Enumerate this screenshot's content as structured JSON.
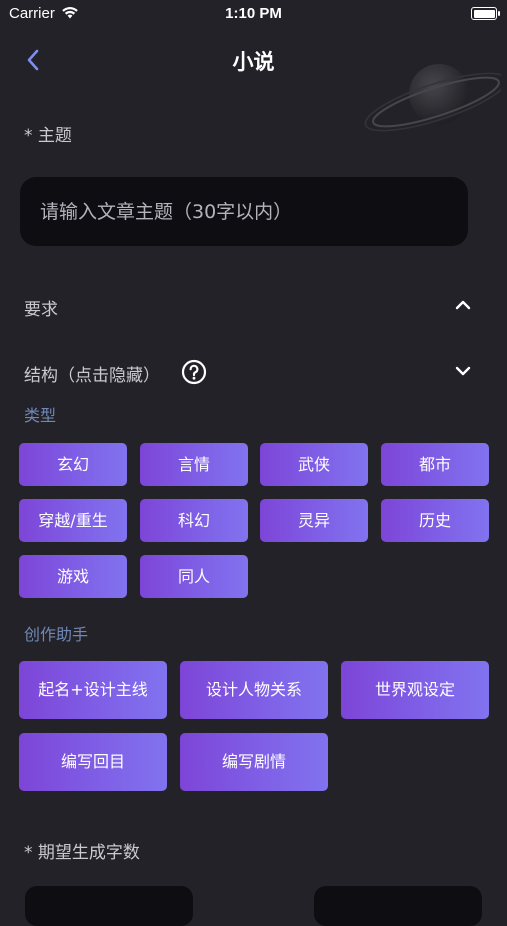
{
  "status_bar": {
    "carrier": "Carrier",
    "time": "1:10 PM"
  },
  "nav": {
    "title": "小说"
  },
  "topic": {
    "label": "* 主题",
    "placeholder": "请输入文章主题（30字以内）"
  },
  "requirements": {
    "label": "要求"
  },
  "structure": {
    "label": "结构（点击隐藏）"
  },
  "genre": {
    "heading": "类型",
    "items": [
      "玄幻",
      "言情",
      "武侠",
      "都市",
      "穿越/重生",
      "科幻",
      "灵异",
      "历史",
      "游戏",
      "同人"
    ]
  },
  "assistant": {
    "heading": "创作助手",
    "items": [
      "起名+设计主线",
      "设计人物关系",
      "世界观设定",
      "编写回目",
      "编写剧情"
    ]
  },
  "word_count": {
    "label": "* 期望生成字数"
  },
  "colors": {
    "background": "#232228",
    "input_background": "#0e0e12",
    "tag_gradient_start": "#7d45d7",
    "tag_gradient_end": "#8173ef",
    "section_heading": "#6f88b6",
    "back_arrow": "#7f8df0"
  },
  "icons": {
    "wifi": "wifi-icon",
    "battery": "battery-icon",
    "back": "back-chevron-icon",
    "planet": "planet-decoration-icon",
    "collapse": "chevron-up-icon",
    "expand": "chevron-down-icon",
    "help": "question-circle-icon"
  }
}
